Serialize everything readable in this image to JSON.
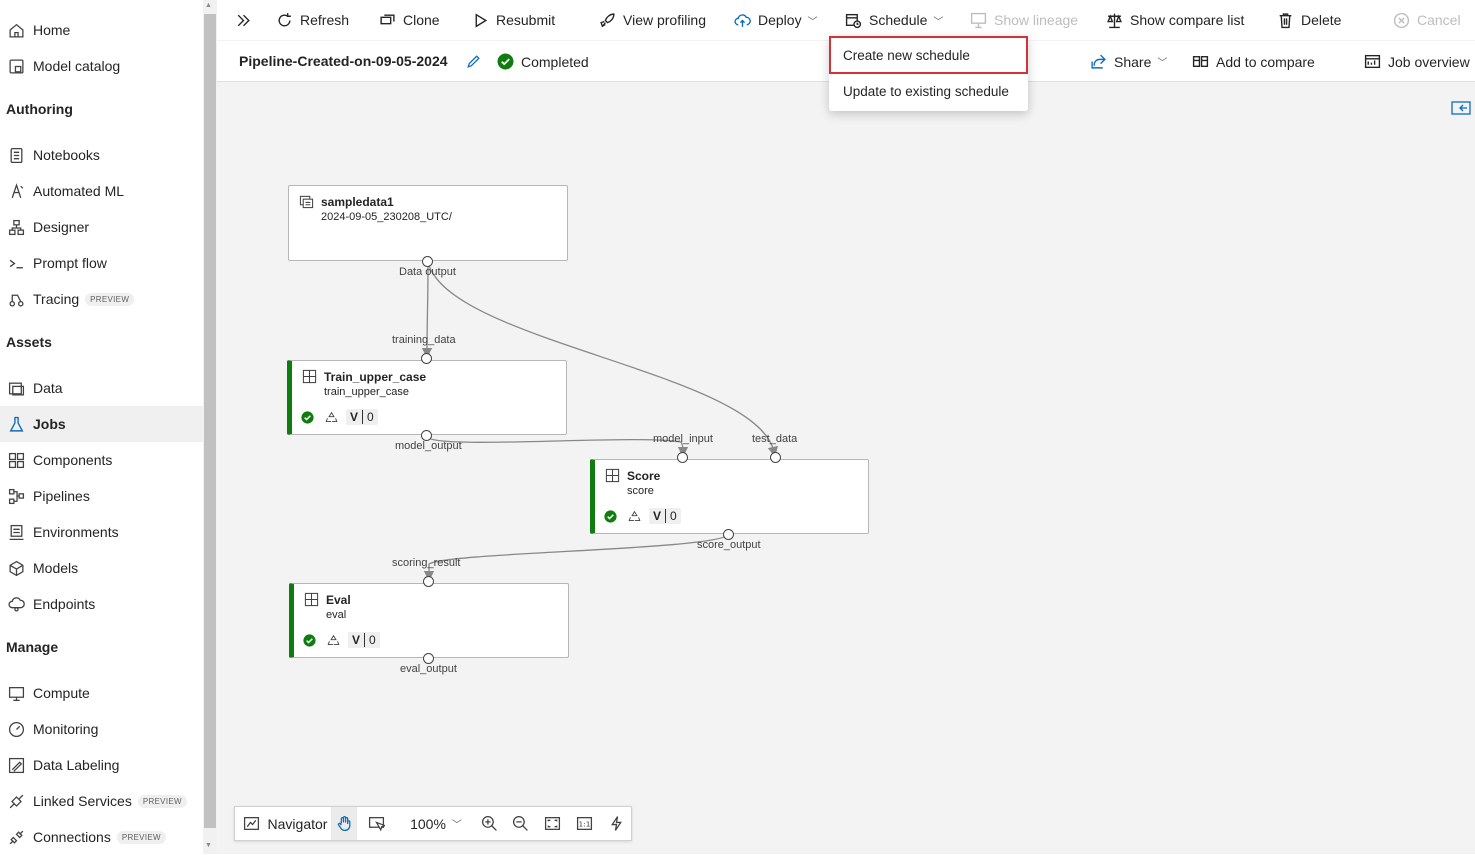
{
  "sidebar": {
    "items_top": [
      {
        "label": "Home",
        "icon": "home-icon"
      },
      {
        "label": "Model catalog",
        "icon": "model-catalog-icon"
      }
    ],
    "sections": [
      {
        "title": "Authoring",
        "items": [
          {
            "label": "Notebooks",
            "icon": "notebook-icon"
          },
          {
            "label": "Automated ML",
            "icon": "automated-ml-icon"
          },
          {
            "label": "Designer",
            "icon": "designer-icon"
          },
          {
            "label": "Prompt flow",
            "icon": "prompt-flow-icon"
          },
          {
            "label": "Tracing",
            "icon": "tracing-icon",
            "badge": "PREVIEW"
          }
        ]
      },
      {
        "title": "Assets",
        "items": [
          {
            "label": "Data",
            "icon": "data-icon"
          },
          {
            "label": "Jobs",
            "icon": "jobs-flask-icon",
            "active": true
          },
          {
            "label": "Components",
            "icon": "components-icon"
          },
          {
            "label": "Pipelines",
            "icon": "pipelines-icon"
          },
          {
            "label": "Environments",
            "icon": "environments-icon"
          },
          {
            "label": "Models",
            "icon": "models-icon"
          },
          {
            "label": "Endpoints",
            "icon": "endpoints-icon"
          }
        ]
      },
      {
        "title": "Manage",
        "items": [
          {
            "label": "Compute",
            "icon": "compute-icon"
          },
          {
            "label": "Monitoring",
            "icon": "monitoring-icon"
          },
          {
            "label": "Data Labeling",
            "icon": "data-labeling-icon"
          },
          {
            "label": "Linked Services",
            "icon": "linked-services-icon",
            "badge": "PREVIEW"
          },
          {
            "label": "Connections",
            "icon": "connections-icon",
            "badge": "PREVIEW"
          }
        ]
      }
    ]
  },
  "toolbar": {
    "refresh": "Refresh",
    "clone": "Clone",
    "resubmit": "Resubmit",
    "view_profiling": "View profiling",
    "deploy": "Deploy",
    "schedule": "Schedule",
    "show_lineage": "Show lineage",
    "show_compare_list": "Show compare list",
    "delete": "Delete",
    "cancel": "Cancel"
  },
  "header": {
    "title": "Pipeline-Created-on-09-05-2024",
    "status": "Completed",
    "share": "Share",
    "add_to_compare": "Add to compare",
    "job_overview": "Job overview"
  },
  "schedule_menu": {
    "create_new": "Create new schedule",
    "update_existing": "Update to existing schedule"
  },
  "graph": {
    "dataset": {
      "title": "sampledata1",
      "subtitle": "2024-09-05_230208_UTC/",
      "output": "Data output"
    },
    "train": {
      "title": "Train_upper_case",
      "subtitle": "train_upper_case",
      "input": "training_data",
      "output": "model_output",
      "version": "V",
      "count": "0"
    },
    "score": {
      "title": "Score",
      "subtitle": "score",
      "input1": "model_input",
      "input2": "test_data",
      "output": "score_output",
      "version": "V",
      "count": "0"
    },
    "eval": {
      "title": "Eval",
      "subtitle": "eval",
      "input": "scoring_result",
      "output": "eval_output",
      "version": "V",
      "count": "0"
    }
  },
  "navigator": {
    "label": "Navigator",
    "zoom": "100%",
    "actual_size": "1:1"
  },
  "colors": {
    "success": "#107c10",
    "highlight": "#d13438",
    "accent": "#0f6cbd"
  }
}
